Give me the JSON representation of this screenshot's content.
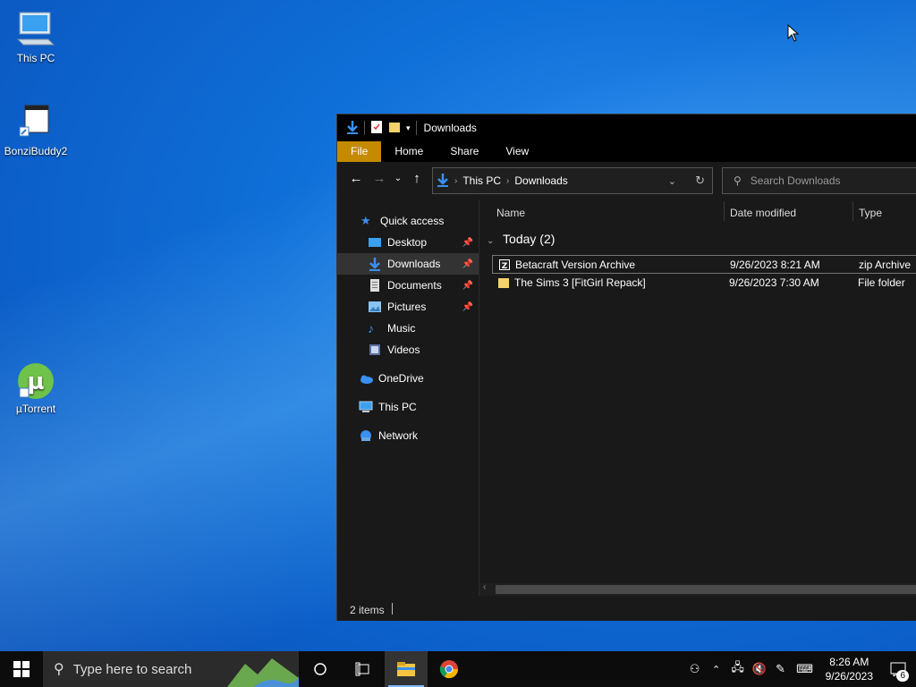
{
  "desktop": {
    "icons": [
      {
        "label": "This PC"
      },
      {
        "label": "BonziBuddy2"
      },
      {
        "label": "µTorrent"
      }
    ]
  },
  "explorer": {
    "title": "Downloads",
    "ribbon_tabs": [
      "File",
      "Home",
      "Share",
      "View"
    ],
    "address": {
      "crumbs": [
        "This PC",
        "Downloads"
      ]
    },
    "search_placeholder": "Search Downloads",
    "nav": {
      "quick_access": "Quick access",
      "desktop": "Desktop",
      "downloads": "Downloads",
      "documents": "Documents",
      "pictures": "Pictures",
      "music": "Music",
      "videos": "Videos",
      "onedrive": "OneDrive",
      "this_pc": "This PC",
      "network": "Network"
    },
    "columns": {
      "name": "Name",
      "date": "Date modified",
      "type": "Type"
    },
    "group": "Today (2)",
    "files": [
      {
        "name": "Betacraft Version Archive",
        "date": "9/26/2023 8:21 AM",
        "type": "zip Archive"
      },
      {
        "name": "The Sims 3 [FitGirl Repack]",
        "date": "9/26/2023 7:30 AM",
        "type": "File folder"
      }
    ],
    "status": "2 items"
  },
  "taskbar": {
    "search_placeholder": "Type here to search",
    "time": "8:26 AM",
    "date": "9/26/2023",
    "notification_count": "6"
  },
  "colors": {
    "accent": "#0f6fd8",
    "file_tab": "#c48a00",
    "window_bg": "#191919"
  }
}
